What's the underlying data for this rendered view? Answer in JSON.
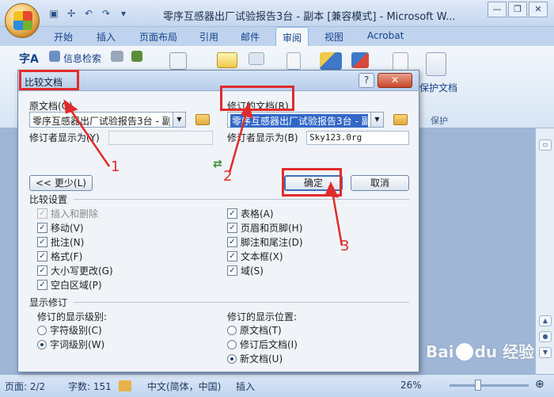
{
  "window": {
    "title": "零序互感器出厂试验报告3台 - 副本 [兼容模式] - Microsoft W...",
    "controls": [
      "—",
      "❐",
      "✕"
    ]
  },
  "ribbon": {
    "tabs": [
      "开始",
      "插入",
      "页面布局",
      "引用",
      "邮件",
      "审阅",
      "视图",
      "Acrobat"
    ],
    "active_tab": "审阅",
    "items": {
      "research": "信息检索",
      "protect": "保护文档",
      "protect_group": "保护"
    }
  },
  "dialog": {
    "title": "比较文档",
    "help": "?",
    "close": "✕",
    "original_label": "原文档(O)",
    "original_value": "零序互感器出厂试验报告3台 - 副",
    "original_author_label": "修订者显示为(Y)",
    "original_author_value": "",
    "revised_label": "修订的文档(R)",
    "revised_value": "零序互感器出厂试验报告3台 - 副",
    "revised_author_label": "修订者显示为(B)",
    "revised_author_value": "Sky123.0rg",
    "less_button": "<< 更少(L)",
    "ok_button": "确定",
    "cancel_button": "取消",
    "compare_settings_title": "比较设置",
    "settings_left": [
      {
        "label": "插入和删除",
        "checked": true,
        "disabled": true
      },
      {
        "label": "移动(V)",
        "checked": true
      },
      {
        "label": "批注(N)",
        "checked": true
      },
      {
        "label": "格式(F)",
        "checked": true
      },
      {
        "label": "大小写更改(G)",
        "checked": true
      },
      {
        "label": "空白区域(P)",
        "checked": true
      }
    ],
    "settings_right": [
      {
        "label": "表格(A)",
        "checked": true
      },
      {
        "label": "页眉和页脚(H)",
        "checked": true
      },
      {
        "label": "脚注和尾注(D)",
        "checked": true
      },
      {
        "label": "文本框(X)",
        "checked": true
      },
      {
        "label": "域(S)",
        "checked": true
      }
    ],
    "show_changes_title": "显示修订",
    "level_title": "修订的显示级别:",
    "level_options": [
      {
        "label": "字符级别(C)",
        "selected": false
      },
      {
        "label": "字词级别(W)",
        "selected": true
      }
    ],
    "location_title": "修订的显示位置:",
    "location_options": [
      {
        "label": "原文档(T)",
        "selected": false
      },
      {
        "label": "修订后文档(I)",
        "selected": false
      },
      {
        "label": "新文档(U)",
        "selected": true
      }
    ]
  },
  "annotations": {
    "num1": "1",
    "num2": "2",
    "num3": "3",
    "color": "#e12b2b"
  },
  "statusbar": {
    "page": "页面: 2/2",
    "words": "字数: 151",
    "language": "中文(简体，中国)",
    "mode": "插入",
    "zoom": "26%"
  },
  "watermark": {
    "text_left": "Bai",
    "text_mid": "du",
    "text_right": "经验"
  }
}
